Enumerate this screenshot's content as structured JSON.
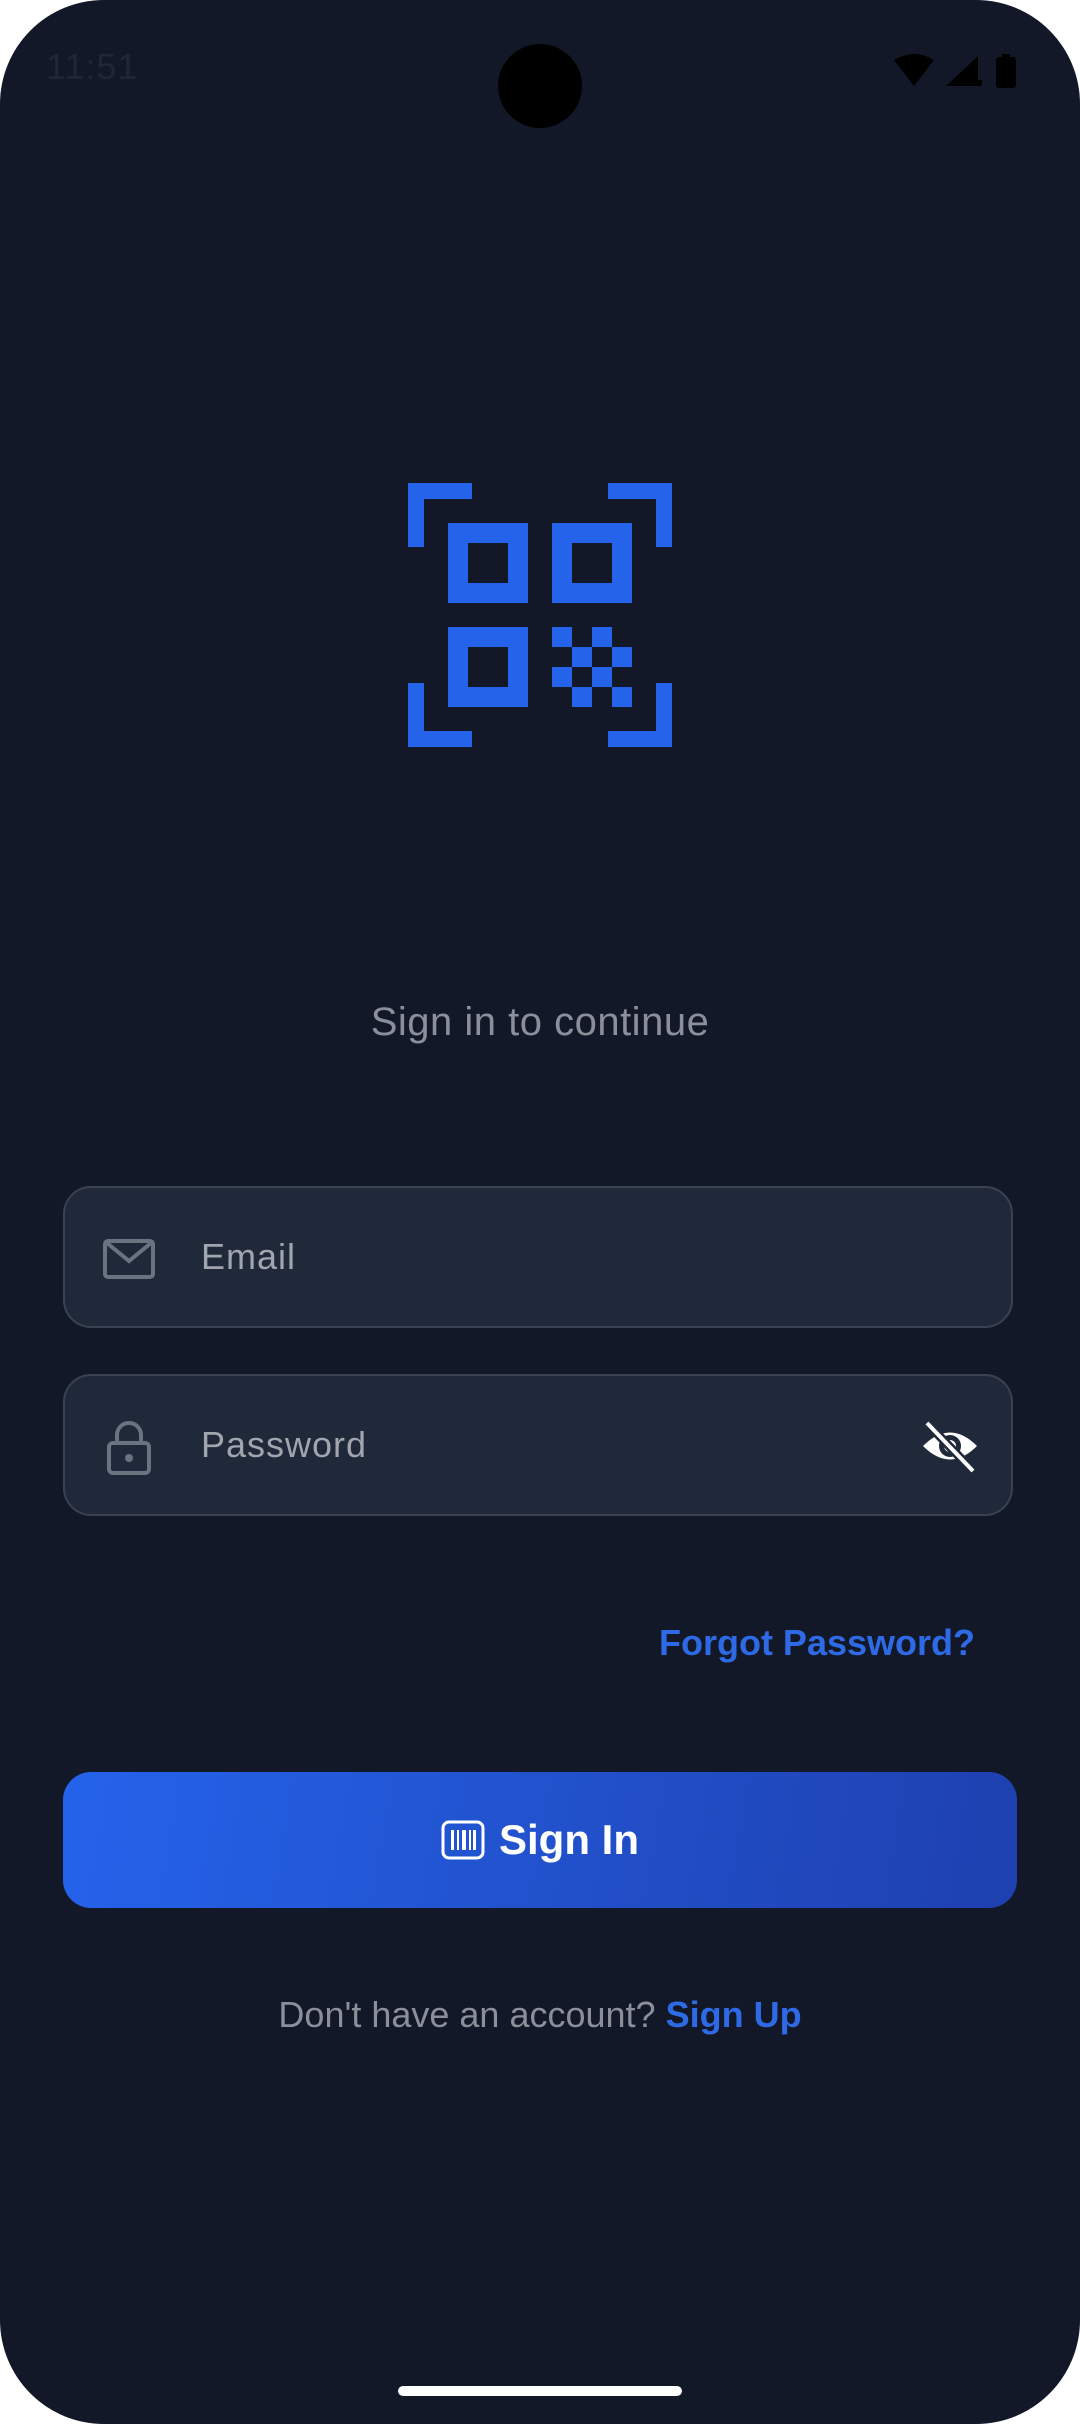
{
  "status_bar": {
    "time": "11:51",
    "icons": [
      "wifi-icon",
      "signal-icon",
      "battery-icon"
    ]
  },
  "logo": {
    "icon": "qr-code-icon",
    "color": "#2563eb"
  },
  "subtitle": "Sign in to continue",
  "form": {
    "email": {
      "placeholder": "Email",
      "icon": "mail-icon"
    },
    "password": {
      "placeholder": "Password",
      "icon": "lock-icon",
      "toggle_icon": "eye-off-icon"
    },
    "forgot_label": "Forgot Password?",
    "submit_label": "Sign In",
    "submit_icon": "barcode-icon"
  },
  "footer": {
    "prompt": "Don't have an account?",
    "link": "Sign Up"
  },
  "colors": {
    "background": "#121828",
    "field_background": "#1f2939",
    "accent": "#2563eb",
    "muted_text": "#8a8f99"
  }
}
